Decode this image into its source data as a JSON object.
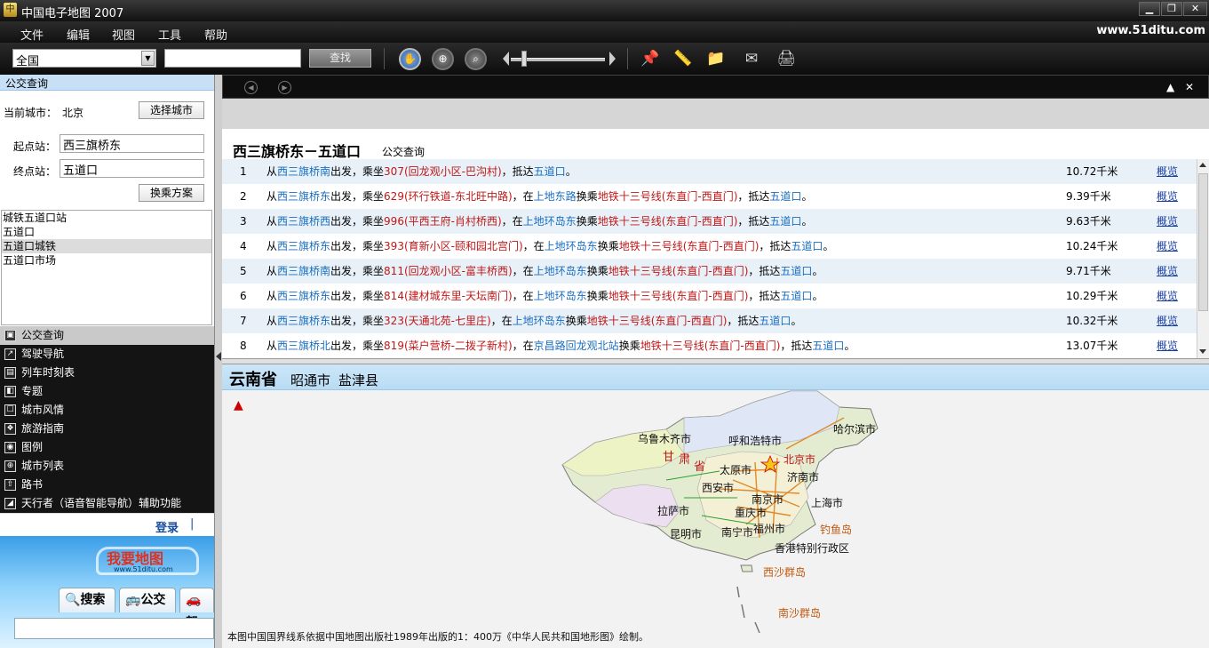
{
  "window": {
    "title": "中国电子地图 2007",
    "app_icon": "app-icon",
    "controls": [
      "minimize-icon",
      "restore-icon",
      "close-icon"
    ]
  },
  "menu": {
    "items": [
      "文件",
      "编辑",
      "视图",
      "工具",
      "帮助"
    ],
    "site_url": "www.51ditu.com"
  },
  "toolbar": {
    "city": "全国",
    "search_value": "",
    "find_label": "查找",
    "icons": [
      "pan-hand-icon",
      "zoom-icon",
      "search-map-icon",
      "pin-icon",
      "ruler-icon",
      "folder-icon",
      "send-icon",
      "print-icon"
    ],
    "zoom_level": 0.12
  },
  "left": {
    "header": "公交查询",
    "current_city_label": "当前城市：",
    "current_city": "北京",
    "choose_city_btn": "选择城市",
    "start_label": "起点站：",
    "start_value": "西三旗桥东",
    "end_label": "终点站：",
    "end_value": "五道口",
    "transfer_btn": "换乘方案",
    "stations": [
      "城铁五道口站",
      "五道口",
      "五道口城铁",
      "五道口市场"
    ],
    "selected_station": 2,
    "nav": [
      {
        "label": "公交查询",
        "icon": "bus-icon"
      },
      {
        "label": "驾驶导航",
        "icon": "route-icon"
      },
      {
        "label": "列车时刻表",
        "icon": "train-icon"
      },
      {
        "label": "专题",
        "icon": "topic-icon"
      },
      {
        "label": "城市风情",
        "icon": "city-icon"
      },
      {
        "label": "旅游指南",
        "icon": "travel-icon"
      },
      {
        "label": "图例",
        "icon": "legend-icon"
      },
      {
        "label": "城市列表",
        "icon": "list-icon"
      },
      {
        "label": "路书",
        "icon": "roadbook-icon"
      },
      {
        "label": "天行者（语音智能导航）辅助功能",
        "icon": "voice-nav-icon"
      }
    ],
    "login": "登录",
    "promo": {
      "logo": "我要地图",
      "url": "www.51ditu.com",
      "tabs": [
        "搜索",
        "公交",
        "驾"
      ]
    }
  },
  "results": {
    "title": "西三旗桥东－五道口",
    "subtitle": "公交查询",
    "overview_label": "概览",
    "rows": [
      {
        "n": "1",
        "parts": [
          [
            "t",
            "从"
          ],
          [
            "b",
            "西三旗桥南"
          ],
          [
            "t",
            "出发，乘坐"
          ],
          [
            "r",
            "307(回龙观小区-巴沟村)"
          ],
          [
            "t",
            "，抵达"
          ],
          [
            "b",
            "五道口"
          ],
          [
            "t",
            "。"
          ]
        ],
        "dist": "10.72千米"
      },
      {
        "n": "2",
        "parts": [
          [
            "t",
            "从"
          ],
          [
            "b",
            "西三旗桥东"
          ],
          [
            "t",
            "出发，乘坐"
          ],
          [
            "r",
            "629(环行铁道-东北旺中路)"
          ],
          [
            "t",
            "，在"
          ],
          [
            "b",
            "上地东路"
          ],
          [
            "t",
            "换乘"
          ],
          [
            "r",
            "地铁十三号线(东直门-西直门)"
          ],
          [
            "t",
            "，抵达"
          ],
          [
            "b",
            "五道口"
          ],
          [
            "t",
            "。"
          ]
        ],
        "dist": "9.39千米"
      },
      {
        "n": "3",
        "parts": [
          [
            "t",
            "从"
          ],
          [
            "b",
            "西三旗桥西"
          ],
          [
            "t",
            "出发，乘坐"
          ],
          [
            "r",
            "996(平西王府-肖村桥西)"
          ],
          [
            "t",
            "，在"
          ],
          [
            "b",
            "上地环岛东"
          ],
          [
            "t",
            "换乘"
          ],
          [
            "r",
            "地铁十三号线(东直门-西直门)"
          ],
          [
            "t",
            "，抵达"
          ],
          [
            "b",
            "五道口"
          ],
          [
            "t",
            "。"
          ]
        ],
        "dist": "9.63千米"
      },
      {
        "n": "4",
        "parts": [
          [
            "t",
            "从"
          ],
          [
            "b",
            "西三旗桥东"
          ],
          [
            "t",
            "出发，乘坐"
          ],
          [
            "r",
            "393(育新小区-颐和园北宫门)"
          ],
          [
            "t",
            "，在"
          ],
          [
            "b",
            "上地环岛东"
          ],
          [
            "t",
            "换乘"
          ],
          [
            "r",
            "地铁十三号线(东直门-西直门)"
          ],
          [
            "t",
            "，抵达"
          ],
          [
            "b",
            "五道口"
          ],
          [
            "t",
            "。"
          ]
        ],
        "dist": "10.24千米"
      },
      {
        "n": "5",
        "parts": [
          [
            "t",
            "从"
          ],
          [
            "b",
            "西三旗桥南"
          ],
          [
            "t",
            "出发，乘坐"
          ],
          [
            "r",
            "811(回龙观小区-富丰桥西)"
          ],
          [
            "t",
            "，在"
          ],
          [
            "b",
            "上地环岛东"
          ],
          [
            "t",
            "换乘"
          ],
          [
            "r",
            "地铁十三号线(东直门-西直门)"
          ],
          [
            "t",
            "，抵达"
          ],
          [
            "b",
            "五道口"
          ],
          [
            "t",
            "。"
          ]
        ],
        "dist": "9.71千米"
      },
      {
        "n": "6",
        "parts": [
          [
            "t",
            "从"
          ],
          [
            "b",
            "西三旗桥东"
          ],
          [
            "t",
            "出发，乘坐"
          ],
          [
            "r",
            "814(建材城东里-天坛南门)"
          ],
          [
            "t",
            "，在"
          ],
          [
            "b",
            "上地环岛东"
          ],
          [
            "t",
            "换乘"
          ],
          [
            "r",
            "地铁十三号线(东直门-西直门)"
          ],
          [
            "t",
            "，抵达"
          ],
          [
            "b",
            "五道口"
          ],
          [
            "t",
            "。"
          ]
        ],
        "dist": "10.29千米"
      },
      {
        "n": "7",
        "parts": [
          [
            "t",
            "从"
          ],
          [
            "b",
            "西三旗桥东"
          ],
          [
            "t",
            "出发，乘坐"
          ],
          [
            "r",
            "323(天通北苑-七里庄)"
          ],
          [
            "t",
            "，在"
          ],
          [
            "b",
            "上地环岛东"
          ],
          [
            "t",
            "换乘"
          ],
          [
            "r",
            "地铁十三号线(东直门-西直门)"
          ],
          [
            "t",
            "，抵达"
          ],
          [
            "b",
            "五道口"
          ],
          [
            "t",
            "。"
          ]
        ],
        "dist": "10.32千米"
      },
      {
        "n": "8",
        "parts": [
          [
            "t",
            "从"
          ],
          [
            "b",
            "西三旗桥北"
          ],
          [
            "t",
            "出发，乘坐"
          ],
          [
            "r",
            "819(菜户营桥-二拨子新村)"
          ],
          [
            "t",
            "，在"
          ],
          [
            "b",
            "京昌路回龙观北站"
          ],
          [
            "t",
            "换乘"
          ],
          [
            "r",
            "地铁十三号线(东直门-西直门)"
          ],
          [
            "t",
            "，抵达"
          ],
          [
            "b",
            "五道口"
          ],
          [
            "t",
            "。"
          ]
        ],
        "dist": "13.07千米"
      }
    ]
  },
  "map": {
    "province": "云南省",
    "city": "昭通市",
    "county": "盐津县",
    "labels": [
      "乌鲁木齐市",
      "呼和浩特市",
      "哈尔滨市",
      "甘",
      "肃",
      "省",
      "北京市",
      "太原市",
      "济南市",
      "西安市",
      "南京市",
      "上海市",
      "拉萨市",
      "重庆市",
      "钓鱼岛",
      "昆明市",
      "南宁市",
      "福州市",
      "香港特别行政区",
      "西沙群岛",
      "南沙群岛"
    ],
    "note": "本图中国国界线系依据中国地图出版社1989年出版的1：400万《中华人民共和国地形图》绘制。"
  }
}
